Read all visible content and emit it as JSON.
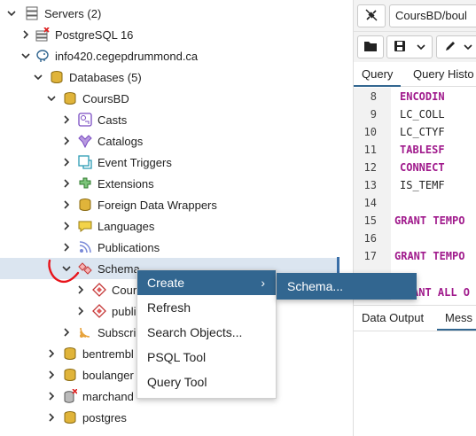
{
  "tree": {
    "items": [
      {
        "label": "Servers (2)",
        "icon": "servers-icon"
      },
      {
        "label": "PostgreSQL 16",
        "icon": "server-disconnected-icon"
      },
      {
        "label": "info420.cegepdrummond.ca",
        "icon": "elephant-server-icon"
      },
      {
        "label": "Databases (5)",
        "icon": "databases-icon"
      },
      {
        "label": "CoursBD",
        "icon": "database-icon"
      },
      {
        "label": "Casts",
        "icon": "casts-icon"
      },
      {
        "label": "Catalogs",
        "icon": "catalogs-icon"
      },
      {
        "label": "Event Triggers",
        "icon": "event-triggers-icon"
      },
      {
        "label": "Extensions",
        "icon": "extensions-icon"
      },
      {
        "label": "Foreign Data Wrappers",
        "icon": "foreign-data-wrappers-icon"
      },
      {
        "label": "Languages",
        "icon": "languages-icon"
      },
      {
        "label": "Publications",
        "icon": "publications-icon"
      },
      {
        "label": "Schema",
        "icon": "schemas-icon"
      },
      {
        "label": "Cour",
        "icon": "schema-icon"
      },
      {
        "label": "publi",
        "icon": "schema-icon"
      },
      {
        "label": "Subscri",
        "icon": "subscriptions-icon"
      },
      {
        "label": "bentrembl",
        "icon": "database-icon"
      },
      {
        "label": "boulanger",
        "icon": "database-icon"
      },
      {
        "label": "marchand",
        "icon": "database-disconnected-icon"
      },
      {
        "label": "postgres",
        "icon": "database-icon"
      }
    ]
  },
  "editor": {
    "connection": "CoursBD/boul",
    "tabs": [
      "Query",
      "Query Histo"
    ],
    "lines": [
      {
        "num": "8",
        "text": "ENCODIN",
        "kind": "kw"
      },
      {
        "num": "9",
        "text": "LC_COLL",
        "kind": "plain"
      },
      {
        "num": "10",
        "text": "LC_CTYF",
        "kind": "plain"
      },
      {
        "num": "11",
        "text": "TABLESF",
        "kind": "kw"
      },
      {
        "num": "12",
        "text": "CONNECT",
        "kind": "kw"
      },
      {
        "num": "13",
        "text": "IS_TEMF",
        "kind": "plain"
      },
      {
        "num": "14",
        "text": "",
        "kind": "plain"
      },
      {
        "num": "15",
        "text": "GRANT TEMPO",
        "kind": "kw"
      },
      {
        "num": "16",
        "text": "",
        "kind": "plain"
      },
      {
        "num": "17",
        "text": "GRANT TEMPO",
        "kind": "kw"
      },
      {
        "num": "",
        "text": "ANT ALL O",
        "kind": "kw"
      }
    ],
    "output_tabs": [
      "Data Output",
      "Mess"
    ]
  },
  "context_menu": {
    "items": [
      "Create",
      "Refresh",
      "Search Objects...",
      "PSQL Tool",
      "Query Tool"
    ],
    "submenu": [
      "Schema..."
    ],
    "arrow": "›"
  },
  "colors": {
    "highlight": "#326690",
    "keyword": "#a01a8c",
    "annotation": "#e8141b"
  }
}
